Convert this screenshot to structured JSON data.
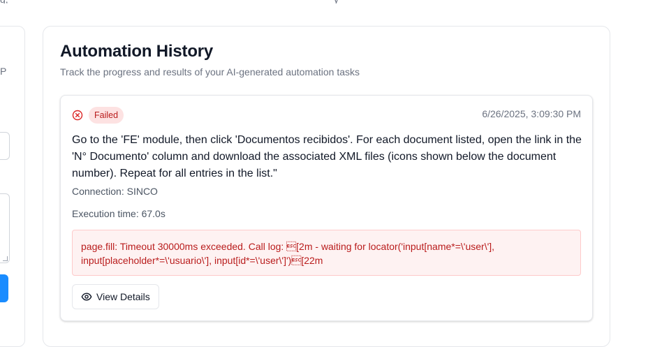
{
  "top_strip": {
    "left_fragment": "g,",
    "right_fragment": "y"
  },
  "left_panel": {
    "fragment_text": "P"
  },
  "history": {
    "title": "Automation History",
    "subtitle": "Track the progress and results of your AI-generated automation tasks"
  },
  "task": {
    "status_label": "Failed",
    "status_icon": "x-circle-icon",
    "timestamp": "6/26/2025, 3:09:30 PM",
    "prompt": "Go to the 'FE' module, then click 'Documentos recibidos'. For each document listed, open the link in the 'N° Documento' column and download the associated XML files (icons shown below the document number). Repeat for all entries in the list.\"",
    "connection": "Connection: SINCO",
    "execution_time": "Execution time: 67.0s",
    "error": "page.fill: Timeout 30000ms exceeded. Call log: \u001b[2m - waiting for locator('input[name*=\\'user\\'], input[placeholder*=\\'usuario\\'], input[id*=\\'user\\']')\u001b[22m",
    "view_details_label": "View Details",
    "view_details_icon": "eye-icon"
  },
  "colors": {
    "failed_text": "#b91c1c",
    "failed_bg": "#fde2e2",
    "error_bg": "#fef2f2",
    "error_border": "#fecaca",
    "primary_button": "#1a8cff"
  }
}
